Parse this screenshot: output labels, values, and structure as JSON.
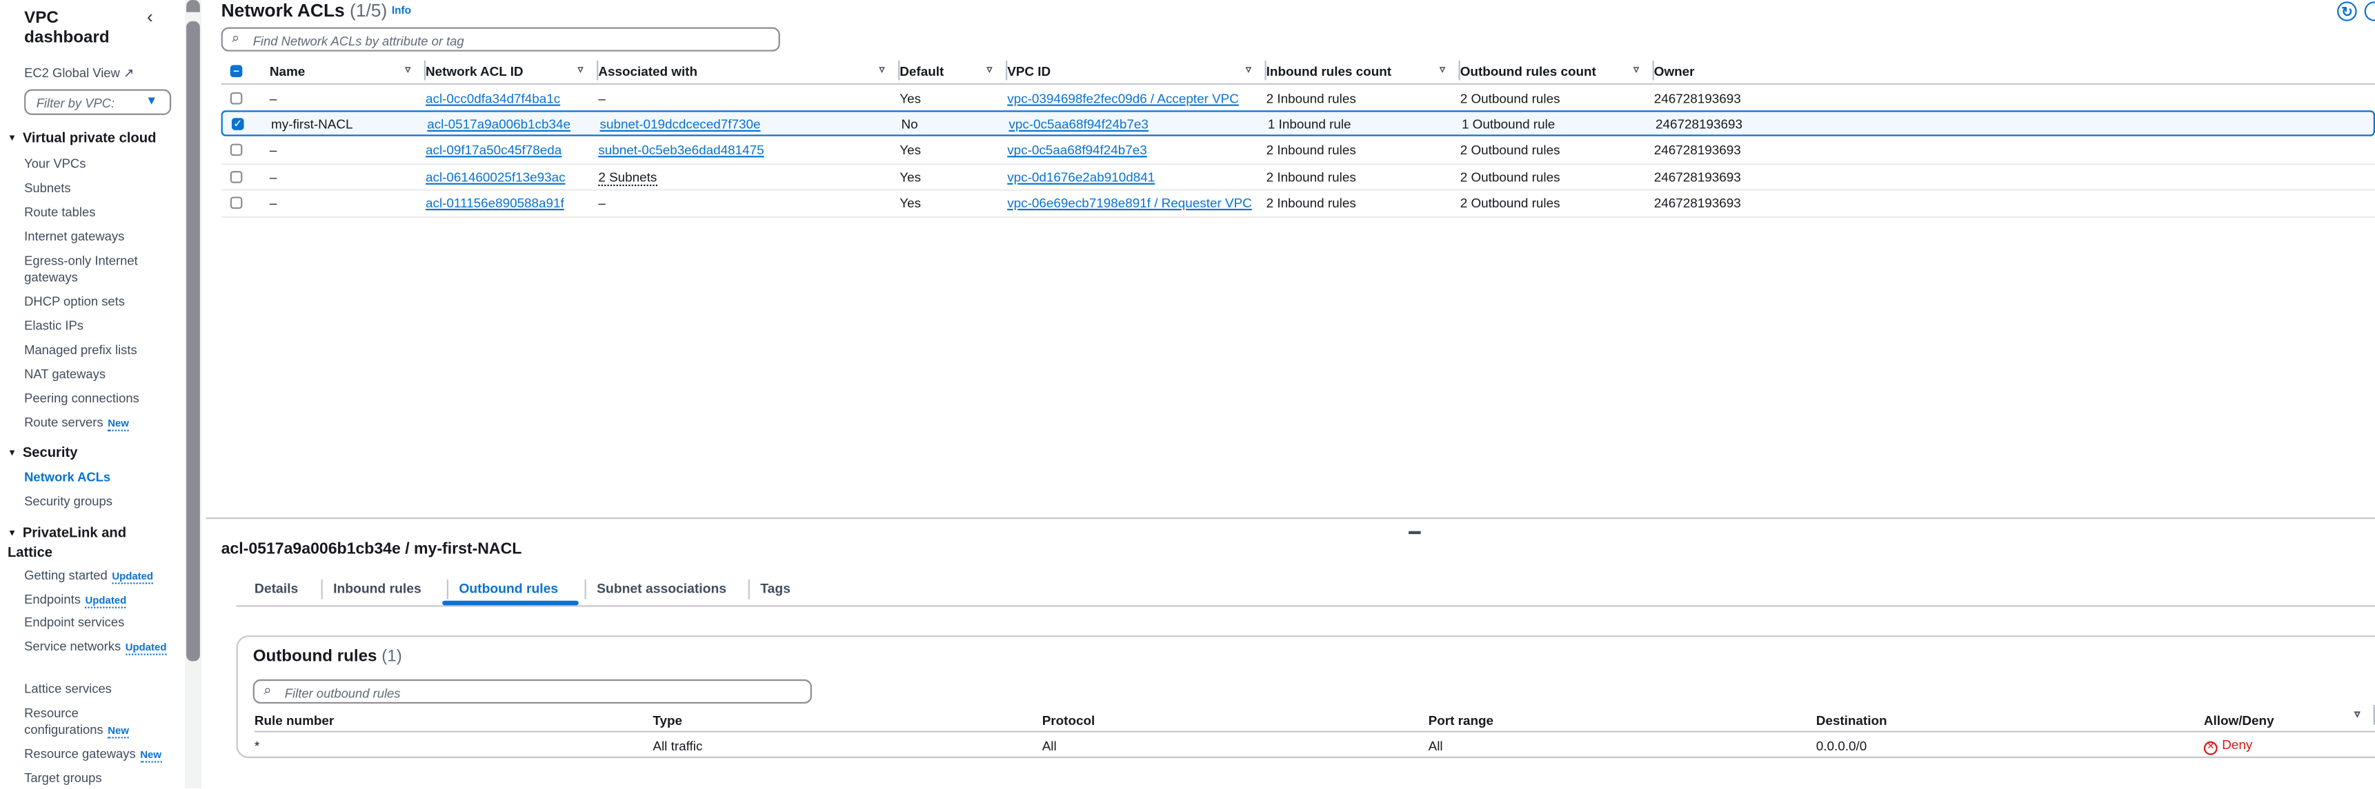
{
  "sidebar": {
    "title": "VPC dashboard",
    "ec2_global_view": "EC2 Global View",
    "filter_placeholder": "Filter by VPC:",
    "sections": [
      {
        "label": "Virtual private cloud",
        "items": [
          {
            "label": "Your VPCs"
          },
          {
            "label": "Subnets"
          },
          {
            "label": "Route tables"
          },
          {
            "label": "Internet gateways"
          },
          {
            "label": "Egress-only Internet gateways"
          },
          {
            "label": "DHCP option sets"
          },
          {
            "label": "Elastic IPs"
          },
          {
            "label": "Managed prefix lists"
          },
          {
            "label": "NAT gateways"
          },
          {
            "label": "Peering connections"
          },
          {
            "label": "Route servers",
            "badge": "New"
          }
        ]
      },
      {
        "label": "Security",
        "items": [
          {
            "label": "Network ACLs",
            "active": true
          },
          {
            "label": "Security groups"
          }
        ]
      },
      {
        "label": "PrivateLink and Lattice",
        "items": [
          {
            "label": "Getting started",
            "badge": "Updated"
          },
          {
            "label": "Endpoints",
            "badge": "Updated"
          },
          {
            "label": "Endpoint services"
          },
          {
            "label": "Service networks",
            "badge": "Updated"
          },
          {
            "label": "Lattice services"
          },
          {
            "label": "Resource configurations",
            "badge": "New"
          },
          {
            "label": "Resource gateways",
            "badge": "New"
          },
          {
            "label": "Target groups"
          }
        ]
      }
    ]
  },
  "main": {
    "title": "Network ACLs",
    "count": "(1/5)",
    "info": "Info",
    "search_placeholder": "Find Network ACLs by attribute or tag",
    "columns": [
      "Name",
      "Network ACL ID",
      "Associated with",
      "Default",
      "VPC ID",
      "Inbound rules count",
      "Outbound rules count",
      "Owner"
    ],
    "rows": [
      {
        "selected": false,
        "name": "–",
        "acl_id": "acl-0cc0dfa34d7f4ba1c",
        "associated": "–",
        "assoc_type": "text",
        "default": "Yes",
        "vpc_id": "vpc-0394698fe2fec09d6 / Accepter VPC",
        "inbound": "2 Inbound rules",
        "outbound": "2 Outbound rules",
        "owner": "246728193693"
      },
      {
        "selected": true,
        "name": "my-first-NACL",
        "acl_id": "acl-0517a9a006b1cb34e",
        "associated": "subnet-019dcdceced7f730e",
        "assoc_type": "link",
        "default": "No",
        "vpc_id": "vpc-0c5aa68f94f24b7e3",
        "inbound": "1 Inbound rule",
        "outbound": "1 Outbound rule",
        "owner": "246728193693"
      },
      {
        "selected": false,
        "name": "–",
        "acl_id": "acl-09f17a50c45f78eda",
        "associated": "subnet-0c5eb3e6dad481475",
        "assoc_type": "link",
        "default": "Yes",
        "vpc_id": "vpc-0c5aa68f94f24b7e3",
        "inbound": "2 Inbound rules",
        "outbound": "2 Outbound rules",
        "owner": "246728193693"
      },
      {
        "selected": false,
        "name": "–",
        "acl_id": "acl-061460025f13e93ac",
        "associated": "2 Subnets",
        "assoc_type": "dotted",
        "default": "Yes",
        "vpc_id": "vpc-0d1676e2ab910d841",
        "inbound": "2 Inbound rules",
        "outbound": "2 Outbound rules",
        "owner": "246728193693"
      },
      {
        "selected": false,
        "name": "–",
        "acl_id": "acl-011156e890588a91f",
        "associated": "–",
        "assoc_type": "text",
        "default": "Yes",
        "vpc_id": "vpc-06e69ecb7198e891f / Requester VPC",
        "inbound": "2 Inbound rules",
        "outbound": "2 Outbound rules",
        "owner": "246728193693"
      }
    ]
  },
  "detail": {
    "title": "acl-0517a9a006b1cb34e / my-first-NACL",
    "tabs": [
      "Details",
      "Inbound rules",
      "Outbound rules",
      "Subnet associations",
      "Tags"
    ],
    "active_tab": "Outbound rules",
    "panel_title": "Outbound rules",
    "panel_count": "(1)",
    "filter_placeholder": "Filter outbound rules",
    "columns": [
      "Rule number",
      "Type",
      "Protocol",
      "Port range",
      "Destination",
      "Allow/Deny"
    ],
    "rules": [
      {
        "rule_number": "*",
        "type": "All traffic",
        "protocol": "All",
        "port_range": "All",
        "destination": "0.0.0.0/0",
        "action": "Deny"
      }
    ]
  },
  "colors": {
    "accent": "#0972d3",
    "deny": "#d91515",
    "selected_row_bg": "#f2f8fd"
  }
}
